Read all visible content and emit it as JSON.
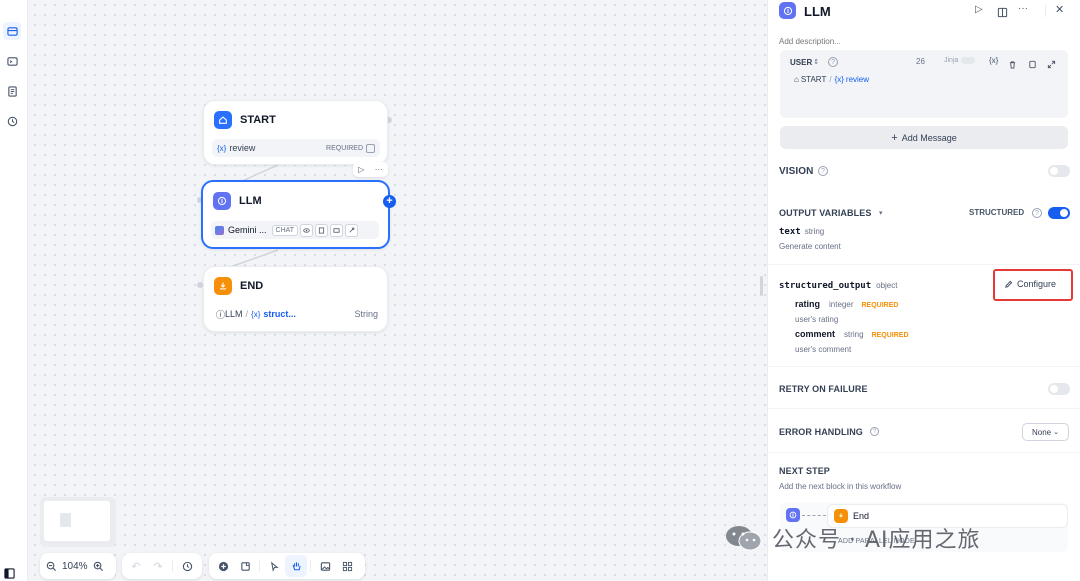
{
  "canvas": {
    "start_node": {
      "title": "START",
      "var_prefix": "{x}",
      "var_name": "review",
      "required": "REQUIRED"
    },
    "llm_node": {
      "title": "LLM",
      "model": "Gemini ...",
      "chat": "CHAT"
    },
    "end_node": {
      "title": "END",
      "src": "LLM",
      "var_prefix": "{x}",
      "var_name": "struct...",
      "type": "String"
    },
    "zoom": "104%"
  },
  "panel": {
    "title": "LLM",
    "description_placeholder": "Add description...",
    "message": {
      "role": "USER",
      "token_count": "26",
      "jinja": "Jinja",
      "source": "START",
      "var_prefix": "{x}",
      "var_name": "review",
      "x_icon": "{x}"
    },
    "add_message": "Add Message",
    "vision": "VISION",
    "output_variables": "OUTPUT VARIABLES",
    "structured": "STRUCTURED",
    "outputs": {
      "text_name": "text",
      "text_type": "string",
      "text_desc": "Generate content"
    },
    "structured_output": {
      "name": "structured_output",
      "type": "object",
      "configure": "Configure",
      "fields": [
        {
          "name": "rating",
          "type": "integer",
          "required": "REQUIRED",
          "desc": "user's rating"
        },
        {
          "name": "comment",
          "type": "string",
          "required": "REQUIRED",
          "desc": "user's comment"
        }
      ]
    },
    "retry": "RETRY ON FAILURE",
    "error_handling": "ERROR HANDLING",
    "error_value": "None",
    "next_step": "NEXT STEP",
    "next_desc": "Add the next block in this workflow",
    "next_node": "End",
    "add_parallel": "ADD PARALLEL NODE"
  },
  "watermark": "公众号 · AI应用之旅",
  "colors": {
    "accent": "#155eef",
    "llm": "#6172f3",
    "start": "#2970ff",
    "end": "#f79009",
    "highlight": "#e53935"
  }
}
